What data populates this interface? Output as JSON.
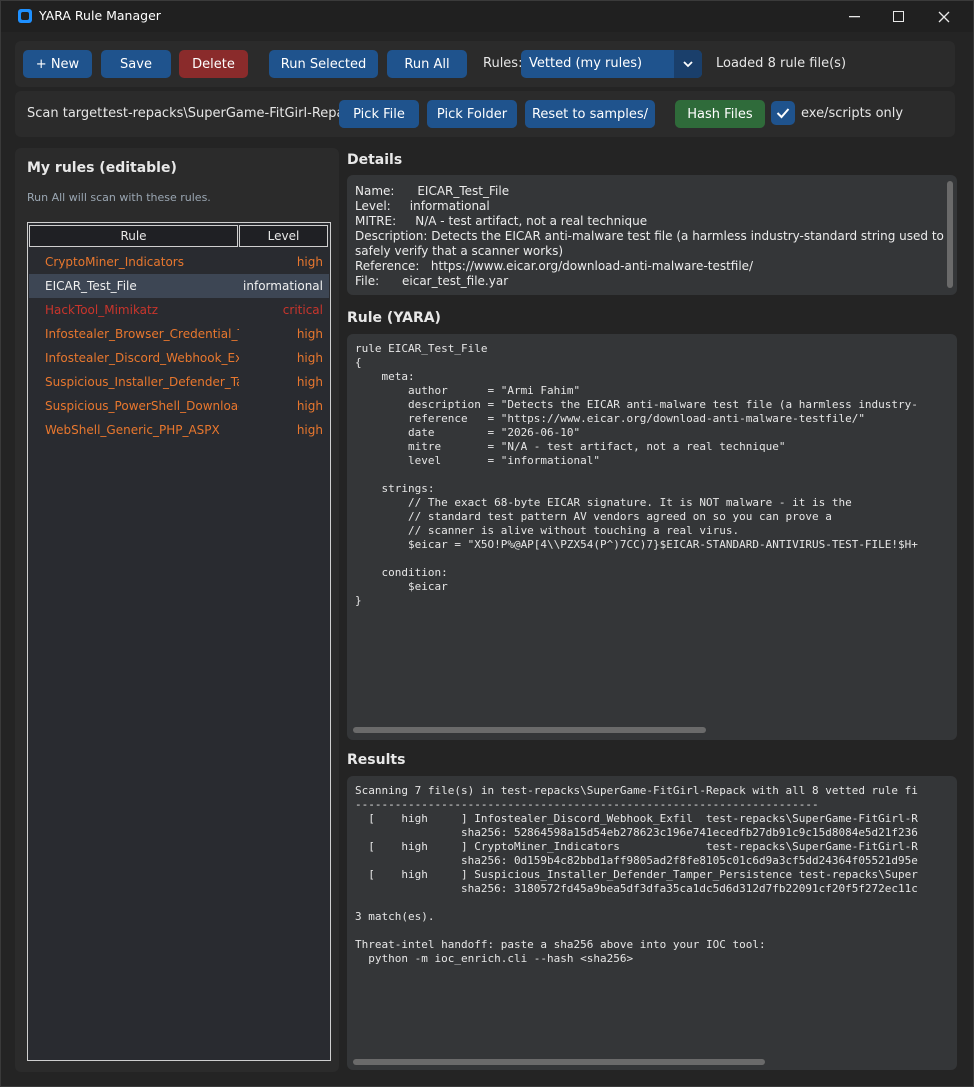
{
  "window": {
    "title": "YARA Rule Manager"
  },
  "toolbar": {
    "new_label": "+ New",
    "save_label": "Save",
    "delete_label": "Delete",
    "run_selected_label": "Run Selected",
    "run_all_label": "Run All",
    "rules_label": "Rules:",
    "rules_select_value": "Vetted (my rules)",
    "status": "Loaded 8 rule file(s)"
  },
  "scanbar": {
    "target_label": "Scan target:",
    "target_value": "test-repacks\\SuperGame-FitGirl-Repack",
    "pick_file_label": "Pick File",
    "pick_folder_label": "Pick Folder",
    "reset_label": "Reset to samples/",
    "hash_label": "Hash Files",
    "exe_only_label": "exe/scripts only",
    "exe_only_checked": true
  },
  "left": {
    "title": "My rules (editable)",
    "subtitle": "Run All will scan with these rules.",
    "col_rule": "Rule",
    "col_level": "Level",
    "rows": [
      {
        "name": "CryptoMiner_Indicators",
        "level": "high",
        "color": "#e8772e"
      },
      {
        "name": "EICAR_Test_File",
        "level": "informational",
        "color": "#f0f0f0"
      },
      {
        "name": "HackTool_Mimikatz",
        "level": "critical",
        "color": "#c8352c"
      },
      {
        "name": "Infostealer_Browser_Credential_Theft",
        "level": "high",
        "color": "#e8772e"
      },
      {
        "name": "Infostealer_Discord_Webhook_Exfil",
        "level": "high",
        "color": "#e8772e"
      },
      {
        "name": "Suspicious_Installer_Defender_Tamper",
        "level": "high",
        "color": "#e8772e"
      },
      {
        "name": "Suspicious_PowerShell_Downloader",
        "level": "high",
        "color": "#e8772e"
      },
      {
        "name": "WebShell_Generic_PHP_ASPX",
        "level": "high",
        "color": "#e8772e"
      }
    ],
    "selected_index": 1
  },
  "details": {
    "title": "Details",
    "lines": [
      "Name:      EICAR_Test_File",
      "Level:     informational",
      "MITRE:     N/A - test artifact, not a real technique",
      "Description: Detects the EICAR anti-malware test file (a harmless industry-standard string used to",
      "safely verify that a scanner works)",
      "Reference:   https://www.eicar.org/download-anti-malware-testfile/",
      "File:      eicar_test_file.yar"
    ]
  },
  "rule": {
    "title": "Rule (YARA)",
    "code": "rule EICAR_Test_File\n{\n    meta:\n        author      = \"Armi Fahim\"\n        description = \"Detects the EICAR anti-malware test file (a harmless industry-\n        reference   = \"https://www.eicar.org/download-anti-malware-testfile/\"\n        date        = \"2026-06-10\"\n        mitre       = \"N/A - test artifact, not a real technique\"\n        level       = \"informational\"\n\n    strings:\n        // The exact 68-byte EICAR signature. It is NOT malware - it is the\n        // standard test pattern AV vendors agreed on so you can prove a\n        // scanner is alive without touching a real virus.\n        $eicar = \"X5O!P%@AP[4\\\\PZX54(P^)7CC)7}$EICAR-STANDARD-ANTIVIRUS-TEST-FILE!$H+\n\n    condition:\n        $eicar\n}"
  },
  "results": {
    "title": "Results",
    "text": "Scanning 7 file(s) in test-repacks\\SuperGame-FitGirl-Repack with all 8 vetted rule fi\n----------------------------------------------------------------------\n  [    high     ] Infostealer_Discord_Webhook_Exfil  test-repacks\\SuperGame-FitGirl-R\n                sha256: 52864598a15d54eb278623c196e741ecedfb27db91c9c15d8084e5d21f236\n  [    high     ] CryptoMiner_Indicators             test-repacks\\SuperGame-FitGirl-R\n                sha256: 0d159b4c82bbd1aff9805ad2f8fe8105c01c6d9a3cf5dd24364f05521d95e\n  [    high     ] Suspicious_Installer_Defender_Tamper_Persistence test-repacks\\Super\n                sha256: 3180572fd45a9bea5df3dfa35ca1dc5d6d312d7fb22091cf20f5f272ec11c\n\n3 match(es).\n\nThreat-intel handoff: paste a sha256 above into your IOC tool:\n  python -m ioc_enrich.cli --hash <sha256>"
  }
}
